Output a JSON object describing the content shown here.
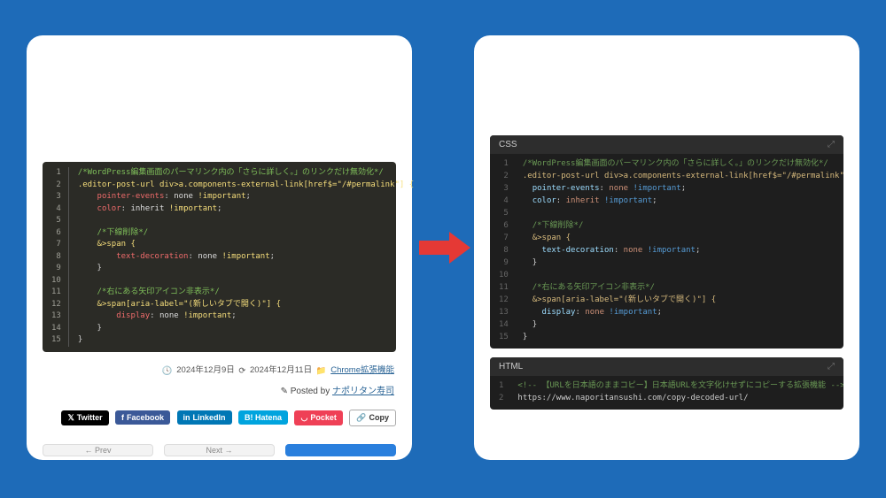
{
  "left": {
    "code_lang": "css",
    "code_lines": [
      {
        "type": "cmt",
        "indent": 0,
        "text": "/*WordPress編集画面のパーマリンク内の「さらに詳しく。」のリンクだけ無効化*/"
      },
      {
        "type": "sel",
        "indent": 0,
        "text": ".editor-post-url div>a.components-external-link[href$=\"/#permalink\"] {"
      },
      {
        "type": "prop",
        "indent": 2,
        "prop": "pointer-events",
        "val": "none",
        "important": true
      },
      {
        "type": "prop",
        "indent": 2,
        "prop": "color",
        "val": "inherit",
        "important": true
      },
      {
        "type": "blank"
      },
      {
        "type": "cmt",
        "indent": 2,
        "text": "/*下線削除*/"
      },
      {
        "type": "sel",
        "indent": 2,
        "text": "&>span {"
      },
      {
        "type": "prop",
        "indent": 4,
        "prop": "text-decoration",
        "val": "none",
        "important": true
      },
      {
        "type": "br",
        "indent": 2,
        "text": "}"
      },
      {
        "type": "blank"
      },
      {
        "type": "cmt",
        "indent": 2,
        "text": "/*右にある矢印アイコン非表示*/"
      },
      {
        "type": "sel",
        "indent": 2,
        "text": "&>span[aria-label=\"(新しいタブで開く)\"] {"
      },
      {
        "type": "prop",
        "indent": 4,
        "prop": "display",
        "val": "none",
        "important": true
      },
      {
        "type": "br",
        "indent": 2,
        "text": "}"
      },
      {
        "type": "br",
        "indent": 0,
        "text": "}"
      }
    ],
    "meta": {
      "date_created": "2024年12月9日",
      "date_updated": "2024年12月11日",
      "category": "Chrome拡張機能",
      "posted_by_label": "Posted by",
      "author": "ナポリタン寿司"
    },
    "share": {
      "twitter": "Twitter",
      "facebook": "Facebook",
      "linkedin": "LinkedIn",
      "hatena": "B! Hatena",
      "pocket": "Pocket",
      "copy": "Copy"
    },
    "nav": {
      "prev": "← Prev",
      "next": "Next →",
      "third": ""
    }
  },
  "right": {
    "css_label": "CSS",
    "css_lines": [
      {
        "type": "cmt",
        "indent": 0,
        "text": "/*WordPress編集画面のパーマリンク内の「さらに詳しく。」のリンクだけ無効化*/"
      },
      {
        "type": "sel",
        "indent": 0,
        "text": ".editor-post-url div>a.components-external-link[href$=\"/#permalink\"] {"
      },
      {
        "type": "prop",
        "indent": 1,
        "prop": "pointer-events",
        "val": "none",
        "important": true
      },
      {
        "type": "prop",
        "indent": 1,
        "prop": "color",
        "val": "inherit",
        "important": true
      },
      {
        "type": "blank"
      },
      {
        "type": "cmt",
        "indent": 1,
        "text": "/*下線削除*/"
      },
      {
        "type": "sel",
        "indent": 1,
        "text": "&>span {"
      },
      {
        "type": "prop",
        "indent": 2,
        "prop": "text-decoration",
        "val": "none",
        "important": true
      },
      {
        "type": "br",
        "indent": 1,
        "text": "}"
      },
      {
        "type": "blank"
      },
      {
        "type": "cmt",
        "indent": 1,
        "text": "/*右にある矢印アイコン非表示*/"
      },
      {
        "type": "sel",
        "indent": 1,
        "text": "&>span[aria-label=\"(新しいタブで開く)\"] {"
      },
      {
        "type": "prop",
        "indent": 2,
        "prop": "display",
        "val": "none",
        "important": true
      },
      {
        "type": "br",
        "indent": 1,
        "text": "}"
      },
      {
        "type": "br",
        "indent": 0,
        "text": "}"
      }
    ],
    "html_label": "HTML",
    "html_lines": [
      {
        "type": "cmt",
        "text": "<!-- 【URLを日本語のままコピー】日本語URLを文字化けせずにコピーする拡張機能 -->"
      },
      {
        "type": "url",
        "text": "https://www.naporitansushi.com/copy-decoded-url/"
      }
    ]
  }
}
